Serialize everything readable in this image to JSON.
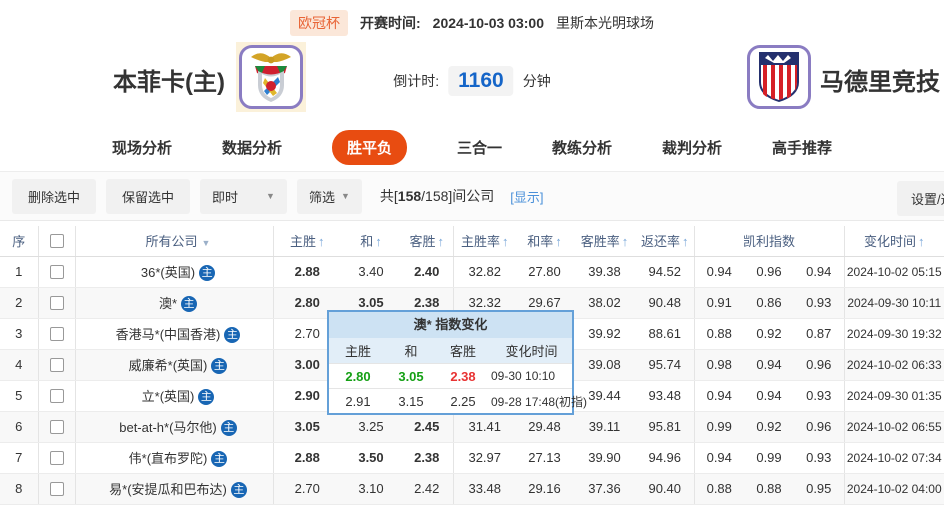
{
  "colors": {
    "green": "#15a015",
    "red": "#e83333",
    "accent_orange": "#e84c11",
    "countdown_blue": "#1565c8",
    "link_blue": "#4a90d9",
    "badge_blue": "#1866b4"
  },
  "header": {
    "league": "欧冠杯",
    "kickoff_label": "开赛时间:",
    "kickoff_time": "2024-10-03 03:00",
    "venue": "里斯本光明球场",
    "home_team": "本菲卡(主)",
    "away_team": "马德里竞技",
    "countdown_label": "倒计时:",
    "countdown_value": "1160",
    "countdown_unit": "分钟"
  },
  "tabs": [
    {
      "label": "现场分析",
      "active": false
    },
    {
      "label": "数据分析",
      "active": false
    },
    {
      "label": "胜平负",
      "active": true
    },
    {
      "label": "三合一",
      "active": false
    },
    {
      "label": "教练分析",
      "active": false
    },
    {
      "label": "裁判分析",
      "active": false
    },
    {
      "label": "高手推荐",
      "active": false
    }
  ],
  "toolbar": {
    "delete_selected": "删除选中",
    "keep_selected": "保留选中",
    "instant_dropdown": "即时",
    "filter_dropdown": "筛选",
    "companies_prefix": "共[",
    "companies_selected": "158",
    "companies_rest": "/158]间公司",
    "show_link": "[显示]",
    "settings_button": "设置/选择"
  },
  "table": {
    "badge": "主",
    "headers": {
      "no": "序",
      "company": "所有公司",
      "home": "主胜",
      "draw": "和",
      "away": "客胜",
      "home_rate": "主胜率",
      "draw_rate": "和率",
      "away_rate": "客胜率",
      "return_rate": "返还率",
      "kelly": "凯利指数",
      "change_time": "变化时间"
    },
    "rows": [
      {
        "no": "1",
        "company": "36*(英国)",
        "home": "2.88",
        "home_c": "g",
        "draw": "3.40",
        "draw_c": "",
        "away": "2.40",
        "away_c": "r",
        "hr": "32.82",
        "dr": "27.80",
        "ar": "39.38",
        "ret": "94.52",
        "k1": "0.94",
        "k2": "0.96",
        "k3": "0.94",
        "time": "2024-10-02 05:15"
      },
      {
        "no": "2",
        "company": "澳*",
        "home": "2.80",
        "home_c": "g",
        "draw": "3.05",
        "draw_c": "g",
        "away": "2.38",
        "away_c": "r",
        "hr": "32.32",
        "dr": "29.67",
        "ar": "38.02",
        "ret": "90.48",
        "k1": "0.91",
        "k2": "0.86",
        "k3": "0.93",
        "time": "2024-09-30 10:11"
      },
      {
        "no": "3",
        "company": "香港马*(中国香港)",
        "home": "2.70",
        "home_c": "",
        "draw": "",
        "draw_c": "",
        "away": "",
        "away_c": "",
        "hr": "",
        "dr": "",
        "ar": "39.92",
        "ret": "88.61",
        "k1": "0.88",
        "k2": "0.92",
        "k3": "0.87",
        "time": "2024-09-30 19:32"
      },
      {
        "no": "4",
        "company": "威廉希*(英国)",
        "home": "3.00",
        "home_c": "g",
        "draw": "",
        "draw_c": "",
        "away": "",
        "away_c": "",
        "hr": "",
        "dr": "",
        "ar": "39.08",
        "ret": "95.74",
        "k1": "0.98",
        "k2": "0.94",
        "k3": "0.96",
        "time": "2024-10-02 06:33"
      },
      {
        "no": "5",
        "company": "立*(英国)",
        "home": "2.90",
        "home_c": "r",
        "draw": "",
        "draw_c": "",
        "away": "",
        "away_c": "",
        "hr": "",
        "dr": "",
        "ar": "39.44",
        "ret": "93.48",
        "k1": "0.94",
        "k2": "0.94",
        "k3": "0.93",
        "time": "2024-09-30 01:35"
      },
      {
        "no": "6",
        "company": "bet-at-h*(马尔他)",
        "home": "3.05",
        "home_c": "r",
        "draw": "3.25",
        "draw_c": "",
        "away": "2.45",
        "away_c": "g",
        "hr": "31.41",
        "dr": "29.48",
        "ar": "39.11",
        "ret": "95.81",
        "k1": "0.99",
        "k2": "0.92",
        "k3": "0.96",
        "time": "2024-10-02 06:55"
      },
      {
        "no": "7",
        "company": "伟*(直布罗陀)",
        "home": "2.88",
        "home_c": "g",
        "draw": "3.50",
        "draw_c": "r",
        "away": "2.38",
        "away_c": "r",
        "hr": "32.97",
        "dr": "27.13",
        "ar": "39.90",
        "ret": "94.96",
        "k1": "0.94",
        "k2": "0.99",
        "k3": "0.93",
        "time": "2024-10-02 07:34"
      },
      {
        "no": "8",
        "company": "易*(安提瓜和巴布达)",
        "home": "2.70",
        "home_c": "",
        "draw": "3.10",
        "draw_c": "",
        "away": "2.42",
        "away_c": "",
        "hr": "33.48",
        "dr": "29.16",
        "ar": "37.36",
        "ret": "90.40",
        "k1": "0.88",
        "k2": "0.88",
        "k3": "0.95",
        "time": "2024-10-02 04:00"
      }
    ]
  },
  "popup": {
    "title": "澳* 指数变化",
    "headers": {
      "home": "主胜",
      "draw": "和",
      "away": "客胜",
      "time": "变化时间"
    },
    "rows": [
      {
        "home": "2.80",
        "home_c": "g",
        "draw": "3.05",
        "draw_c": "g",
        "away": "2.38",
        "away_c": "r",
        "time": "09-30 10:10"
      },
      {
        "home": "2.91",
        "home_c": "",
        "draw": "3.15",
        "draw_c": "",
        "away": "2.25",
        "away_c": "",
        "time": "09-28 17:48(初指)"
      }
    ]
  }
}
